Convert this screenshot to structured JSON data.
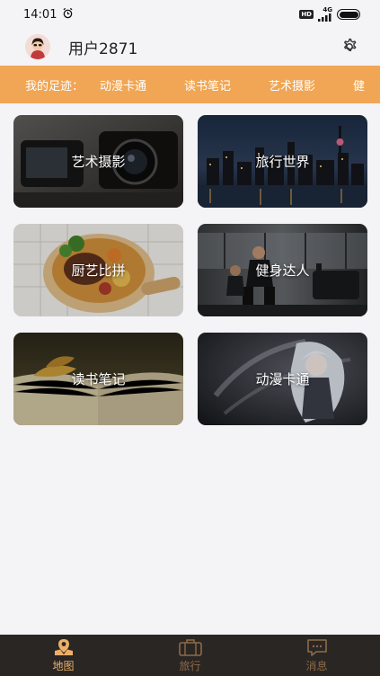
{
  "status_bar": {
    "time": "14:01",
    "network": "4G"
  },
  "header": {
    "username": "用户2871"
  },
  "footprint": {
    "label": "我的足迹：",
    "items": [
      "动漫卡通",
      "读书笔记",
      "艺术摄影",
      "健"
    ]
  },
  "categories": [
    {
      "label": "艺术摄影",
      "icon": "camera-photo"
    },
    {
      "label": "旅行世界",
      "icon": "city-night"
    },
    {
      "label": "厨艺比拼",
      "icon": "food-bowl"
    },
    {
      "label": "健身达人",
      "icon": "gym"
    },
    {
      "label": "读书笔记",
      "icon": "open-book"
    },
    {
      "label": "动漫卡通",
      "icon": "anime-girl"
    }
  ],
  "tabs": [
    {
      "label": "地图",
      "icon": "map-pin-icon",
      "active": true
    },
    {
      "label": "旅行",
      "icon": "suitcase-icon",
      "active": false
    },
    {
      "label": "消息",
      "icon": "message-icon",
      "active": false
    }
  ],
  "colors": {
    "accent": "#f0a654",
    "tab_active": "#ecb06b",
    "tab_inactive": "#8d6b46",
    "tab_bar_bg": "#2a2624"
  }
}
